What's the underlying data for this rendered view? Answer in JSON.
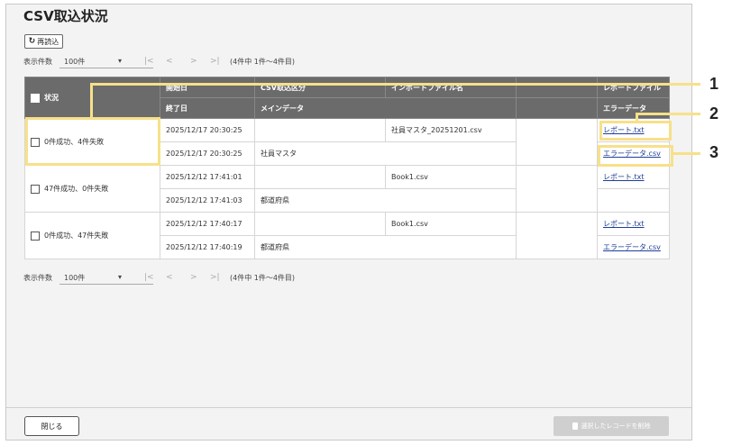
{
  "page": {
    "title": "CSV取込状況"
  },
  "toolbar": {
    "reload_label": "再読込",
    "reload_icon": "refresh-icon"
  },
  "pager_top": {
    "label": "表示件数",
    "value": "100件",
    "first": "|<",
    "prev": "<",
    "next": ">",
    "last": ">|",
    "range": "(4件中 1件～4件目)"
  },
  "pager_bottom": {
    "label": "表示件数",
    "value": "100件",
    "first": "|<",
    "prev": "<",
    "next": ">",
    "last": ">|",
    "range": "(4件中 1件～4件目)"
  },
  "table": {
    "headers": {
      "state": "状況",
      "start": "開始日",
      "end": "終了日",
      "type": "CSV取込区分",
      "main": "メインデータ",
      "file": "インポートファイル名",
      "report": "レポートファイル",
      "error": "エラーデータ"
    },
    "rows": [
      {
        "state": "0件成功、4件失敗",
        "start": "2025/12/17 20:30:25",
        "end": "2025/12/17 20:30:25",
        "file": "社員マスタ_20251201.csv",
        "main": "社員マスタ",
        "report": "レポート.txt",
        "error": "エラーデータ.csv"
      },
      {
        "state": "47件成功、0件失敗",
        "start": "2025/12/12 17:41:01",
        "end": "2025/12/12 17:41:03",
        "file": "Book1.csv",
        "main": "都道府県",
        "report": "レポート.txt",
        "error": ""
      },
      {
        "state": "0件成功、47件失敗",
        "start": "2025/12/12 17:40:17",
        "end": "2025/12/12 17:40:19",
        "file": "Book1.csv",
        "main": "都道府県",
        "report": "レポート.txt",
        "error": "エラーデータ.csv"
      }
    ]
  },
  "callouts": [
    "1",
    "2",
    "3"
  ],
  "footer": {
    "close_label": "閉じる",
    "delete_label": "選択したレコードを削除"
  },
  "colors": {
    "header_bg": "#6b6b6b",
    "link": "#1f3f99",
    "callout": "#f7e08a",
    "disabled_btn": "#cfcfcf"
  }
}
